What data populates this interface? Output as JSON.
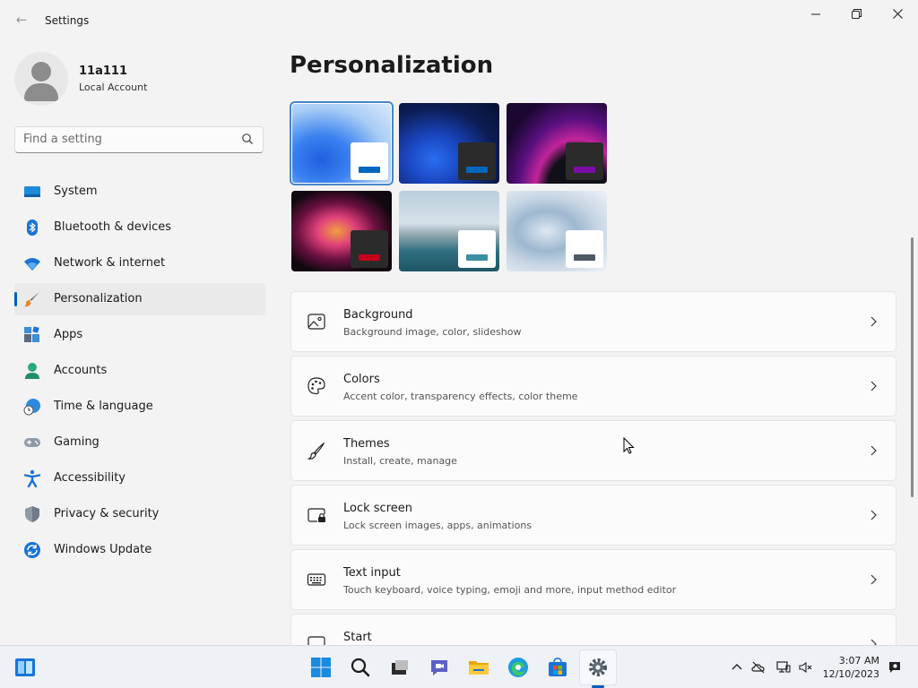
{
  "window": {
    "title": "Settings",
    "back_icon": "back-arrow-icon",
    "minimize_icon": "minimize-icon",
    "maximize_icon": "restore-icon",
    "close_icon": "close-icon"
  },
  "user": {
    "name": "11a111",
    "account_type": "Local Account"
  },
  "search": {
    "placeholder": "Find a setting"
  },
  "sidebar": {
    "items": [
      {
        "label": "System",
        "icon": "system-icon"
      },
      {
        "label": "Bluetooth & devices",
        "icon": "bluetooth-icon"
      },
      {
        "label": "Network & internet",
        "icon": "wifi-icon"
      },
      {
        "label": "Personalization",
        "icon": "brush-icon",
        "active": true
      },
      {
        "label": "Apps",
        "icon": "apps-icon"
      },
      {
        "label": "Accounts",
        "icon": "accounts-icon"
      },
      {
        "label": "Time & language",
        "icon": "clock-globe-icon"
      },
      {
        "label": "Gaming",
        "icon": "gamepad-icon"
      },
      {
        "label": "Accessibility",
        "icon": "accessibility-icon"
      },
      {
        "label": "Privacy & security",
        "icon": "shield-icon"
      },
      {
        "label": "Windows Update",
        "icon": "update-icon"
      }
    ]
  },
  "main": {
    "title": "Personalization",
    "themes": [
      {
        "name": "windows-light",
        "accent": "#0067c0",
        "selected": true
      },
      {
        "name": "windows-dark",
        "accent": "#0067c0"
      },
      {
        "name": "glow",
        "accent": "#7a0ea5"
      },
      {
        "name": "captured-motion",
        "accent": "#c4001a"
      },
      {
        "name": "sunrise",
        "accent": "#3a8fa3"
      },
      {
        "name": "flow",
        "accent": "#4e5a66"
      }
    ],
    "cards": [
      {
        "title": "Background",
        "subtitle": "Background image, color, slideshow",
        "icon": "picture-icon"
      },
      {
        "title": "Colors",
        "subtitle": "Accent color, transparency effects, color theme",
        "icon": "palette-icon"
      },
      {
        "title": "Themes",
        "subtitle": "Install, create, manage",
        "icon": "brush-icon"
      },
      {
        "title": "Lock screen",
        "subtitle": "Lock screen images, apps, animations",
        "icon": "lock-screen-icon"
      },
      {
        "title": "Text input",
        "subtitle": "Touch keyboard, voice typing, emoji and more, input method editor",
        "icon": "keyboard-icon"
      },
      {
        "title": "Start",
        "subtitle": "",
        "icon": "start-icon"
      }
    ]
  },
  "taskbar": {
    "time": "3:07 AM",
    "date": "12/10/2023",
    "accent": "#005fb8"
  }
}
